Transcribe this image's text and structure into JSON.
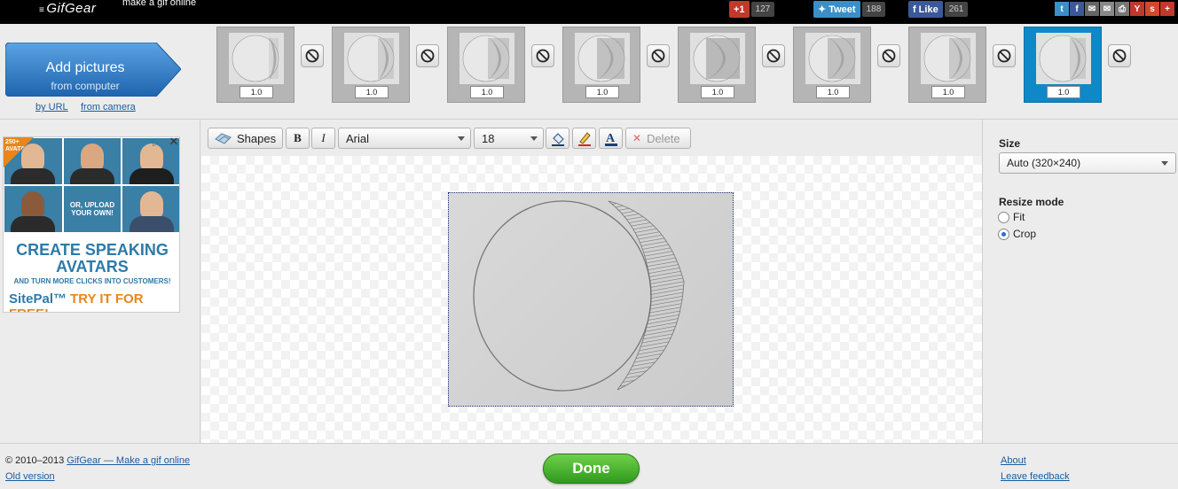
{
  "header": {
    "logo": "GifGear",
    "tagline": "make a gif online",
    "social": [
      {
        "label": "+1",
        "count": "127",
        "color": "#c0392b"
      },
      {
        "label": "Tweet",
        "count": "188",
        "color": "#3a8fc8"
      },
      {
        "label": "Like",
        "count": "261",
        "color": "#3b5998"
      }
    ],
    "share_icons": [
      "twitter-icon",
      "facebook-icon",
      "email-icon",
      "email-alt-icon",
      "print-icon",
      "yahoo-icon",
      "stumbleupon-icon",
      "more-icon"
    ]
  },
  "add_pictures": {
    "title": "Add pictures",
    "subtitle": "from computer",
    "by_url": "by URL",
    "from_camera": "from camera"
  },
  "frames": [
    {
      "duration": "1.0",
      "shade": 0.05
    },
    {
      "duration": "1.0",
      "shade": 0.3
    },
    {
      "duration": "1.0",
      "shade": 0.5
    },
    {
      "duration": "1.0",
      "shade": 0.75
    },
    {
      "duration": "1.0",
      "shade": 1.0
    },
    {
      "duration": "1.0",
      "shade": 0.75
    },
    {
      "duration": "1.0",
      "shade": 0.5
    },
    {
      "duration": "1.0",
      "shade": 0.3,
      "selected": true
    }
  ],
  "ad": {
    "badge": "250+ AVATARS",
    "upload_text": "OR, UPLOAD YOUR OWN!",
    "headline": "CREATE SPEAKING AVATARS",
    "subline": "AND TURN MORE CLICKS INTO CUSTOMERS!",
    "brand": "SitePal™",
    "cta": "TRY IT FOR FREE!"
  },
  "toolbar": {
    "shapes": "Shapes",
    "bold": "B",
    "italic": "I",
    "font": "Arial",
    "font_size": "18",
    "delete": "Delete"
  },
  "settings": {
    "size_label": "Size",
    "size_value": "Auto (320×240)",
    "resize_label": "Resize mode",
    "fit": "Fit",
    "crop": "Crop",
    "selected_mode": "crop"
  },
  "footer": {
    "copyright": "© 2010–2013",
    "site_link": "GifGear — Make a gif online",
    "old_version": "Old version",
    "done": "Done",
    "about": "About",
    "feedback": "Leave feedback"
  }
}
